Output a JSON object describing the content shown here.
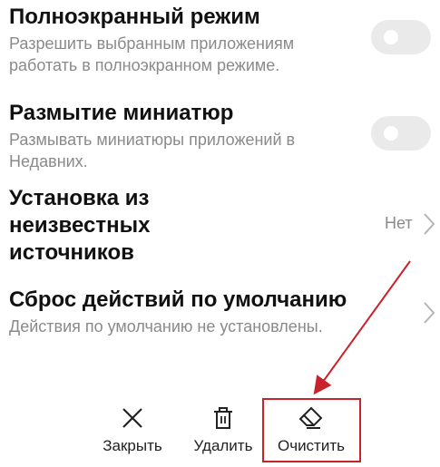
{
  "settings": {
    "fullscreen": {
      "title": "Полноэкранный режим",
      "subtitle": "Разрешить выбранным приложениям работать в полноэкранном режиме.",
      "enabled": false
    },
    "blur": {
      "title": "Размытие миниатюр",
      "subtitle": "Размывать миниатюры приложений в Недавних.",
      "enabled": false
    },
    "unknown_sources": {
      "title_line1": "Установка из",
      "title_line2": "неизвестных",
      "title_line3": "источников",
      "value": "Нет"
    },
    "reset_defaults": {
      "title": "Сброс действий по умолчанию",
      "subtitle": "Действия по умолчанию не установлены."
    }
  },
  "bottom_bar": {
    "close_label": "Закрыть",
    "delete_label": "Удалить",
    "clear_label": "Очистить"
  },
  "annotation": {
    "color": "#c8232c",
    "highlighted": "clear-button"
  }
}
